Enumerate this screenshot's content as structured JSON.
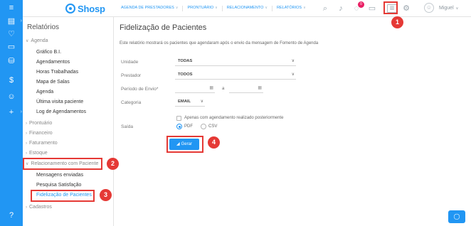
{
  "app": {
    "logo_text": "Shosp"
  },
  "breadcrumbs": [
    {
      "label": "AGENDA DE PRESTADORES"
    },
    {
      "label": "PRONTUÁRIO"
    },
    {
      "label": "RELACIONAMENTO"
    },
    {
      "label": "RELATÓRIOS"
    }
  ],
  "topbar": {
    "notification_count": "0",
    "user_name": "Miguel"
  },
  "sidebar": {
    "title": "Relatórios",
    "agenda_group": "Agenda",
    "agenda_items": [
      "Gráfico B.I.",
      "Agendamentos",
      "Horas Trabalhadas",
      "Mapa de Salas",
      "Agenda",
      "Última visita paciente",
      "Log de Agendamentos"
    ],
    "other_groups": [
      "Prontuário",
      "Financeiro",
      "Faturamento",
      "Estoque"
    ],
    "rel_group": "Relacionamento com Paciente",
    "rel_items": [
      "Mensagens enviadas",
      "Pesquisa Satisfação",
      "Fidelização de Pacientes"
    ],
    "last_group": "Cadastros"
  },
  "main": {
    "title": "Fidelização de Pacientes",
    "description": "Este relatório mostrará os pacientes que agendaram após o envio da mensagem de Fomento de Agenda",
    "fields": {
      "unidade_label": "Unidade",
      "unidade_value": "TODAS",
      "prestador_label": "Prestador",
      "prestador_value": "TODOS",
      "periodo_label": "Período de Envio*",
      "periodo_sep": "a",
      "categoria_label": "Categoria",
      "categoria_value": "EMAIL",
      "checkbox_label": "Apenas com agendamento realizado posteriormente",
      "saida_label": "Saída",
      "saida_pdf": "PDF",
      "saida_csv": "CSV"
    },
    "generate_label": "Gerar"
  },
  "annotations": [
    "1",
    "2",
    "3",
    "4"
  ],
  "colors": {
    "accent": "#2196f3",
    "annotation": "#e53935"
  }
}
